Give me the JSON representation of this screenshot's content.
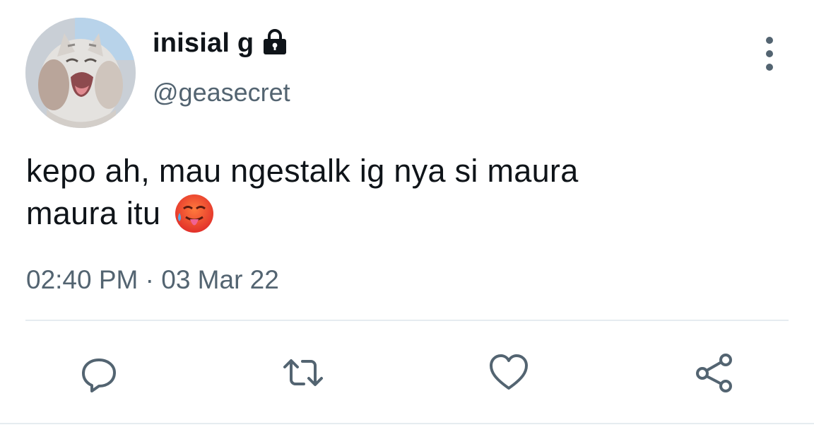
{
  "tweet": {
    "display_name": "inisial g",
    "protected_icon": "lock-icon",
    "handle": "@geasecret",
    "text_line1": "kepo ah, mau ngestalk ig nya si maura",
    "text_line2": "maura itu",
    "emoji": "hot-face-emoji",
    "timestamp": "02:40 PM · 03 Mar 22"
  },
  "actions": {
    "reply_icon": "reply-icon",
    "retweet_icon": "retweet-icon",
    "like_icon": "heart-icon",
    "share_icon": "share-icon",
    "more_icon": "more-vertical-icon"
  },
  "colors": {
    "text_primary": "#0f1419",
    "text_secondary": "#536471",
    "divider": "#e6ecf0"
  }
}
